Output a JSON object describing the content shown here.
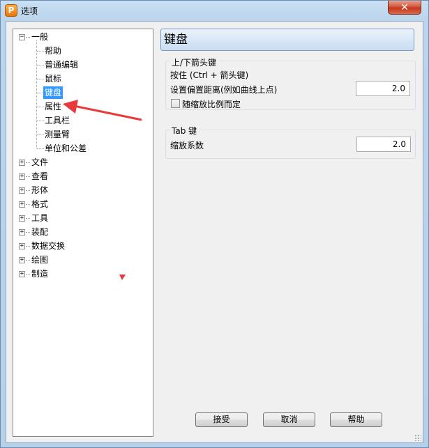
{
  "window": {
    "title": "选项",
    "close_label": "✕"
  },
  "tree": {
    "root_general": "一般",
    "general_children": [
      "帮助",
      "普通编辑",
      "鼠标",
      "键盘",
      "属性",
      "工具栏",
      "测量臂",
      "单位和公差"
    ],
    "selected": "键盘",
    "other_roots": [
      "文件",
      "查看",
      "形体",
      "格式",
      "工具",
      "装配",
      "数据交换",
      "绘图",
      "制造"
    ],
    "expanded_glyph": "−",
    "collapsed_glyph": "+"
  },
  "panel": {
    "header": "键盘",
    "arrow_group": {
      "title": "上/下箭头键",
      "hint": "按住 (Ctrl + 箭头键)",
      "offset_label": "设置偏置距离(例如曲线上点)",
      "offset_value": "2.0",
      "checkbox_label": "随缩放比例而定",
      "checkbox_checked": false
    },
    "tab_group": {
      "title": "Tab 键",
      "scale_label": "缩放系数",
      "scale_value": "2.0"
    }
  },
  "buttons": {
    "ok": "接受",
    "cancel": "取消",
    "help": "帮助"
  },
  "colors": {
    "selection": "#3399ff",
    "annotation_arrow": "#e83a3a"
  }
}
